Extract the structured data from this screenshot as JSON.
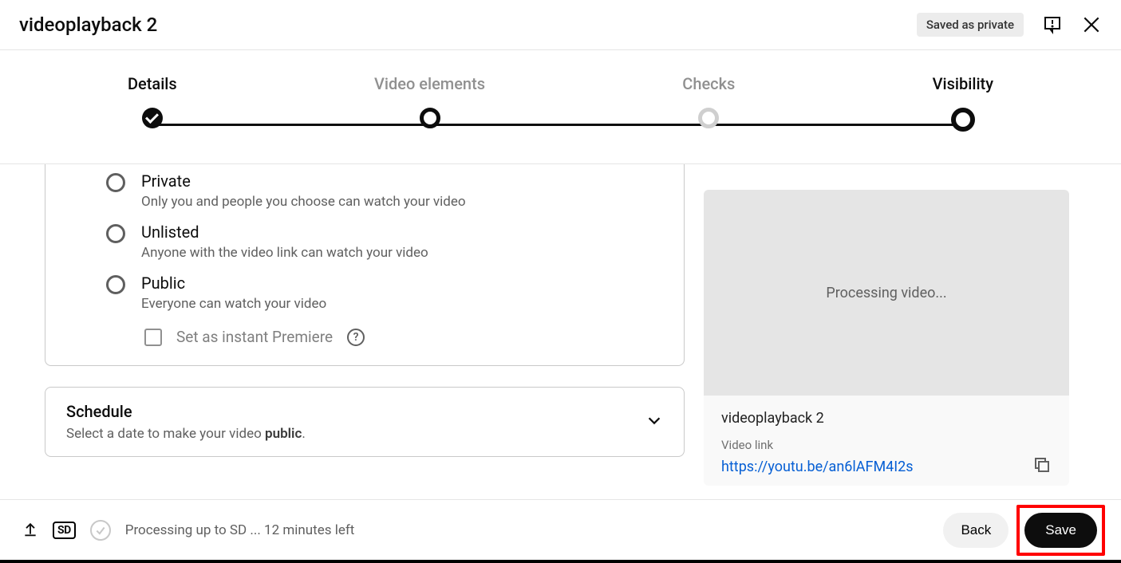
{
  "header": {
    "title": "videoplayback 2",
    "saved_badge": "Saved as private"
  },
  "stepper": {
    "steps": [
      {
        "label": "Details"
      },
      {
        "label": "Video elements"
      },
      {
        "label": "Checks"
      },
      {
        "label": "Visibility"
      }
    ]
  },
  "visibility": {
    "options": [
      {
        "title": "Private",
        "desc": "Only you and people you choose can watch your video"
      },
      {
        "title": "Unlisted",
        "desc": "Anyone with the video link can watch your video"
      },
      {
        "title": "Public",
        "desc": "Everyone can watch your video"
      }
    ],
    "premiere_label": "Set as instant Premiere"
  },
  "schedule": {
    "title": "Schedule",
    "desc_prefix": "Select a date to make your video ",
    "desc_bold": "public",
    "desc_suffix": "."
  },
  "preview": {
    "processing": "Processing video...",
    "title": "videoplayback 2",
    "link_label": "Video link",
    "link": "https://youtu.be/an6lAFM4I2s"
  },
  "footer": {
    "sd": "SD",
    "processing": "Processing up to SD ... 12 minutes left",
    "back": "Back",
    "save": "Save"
  }
}
